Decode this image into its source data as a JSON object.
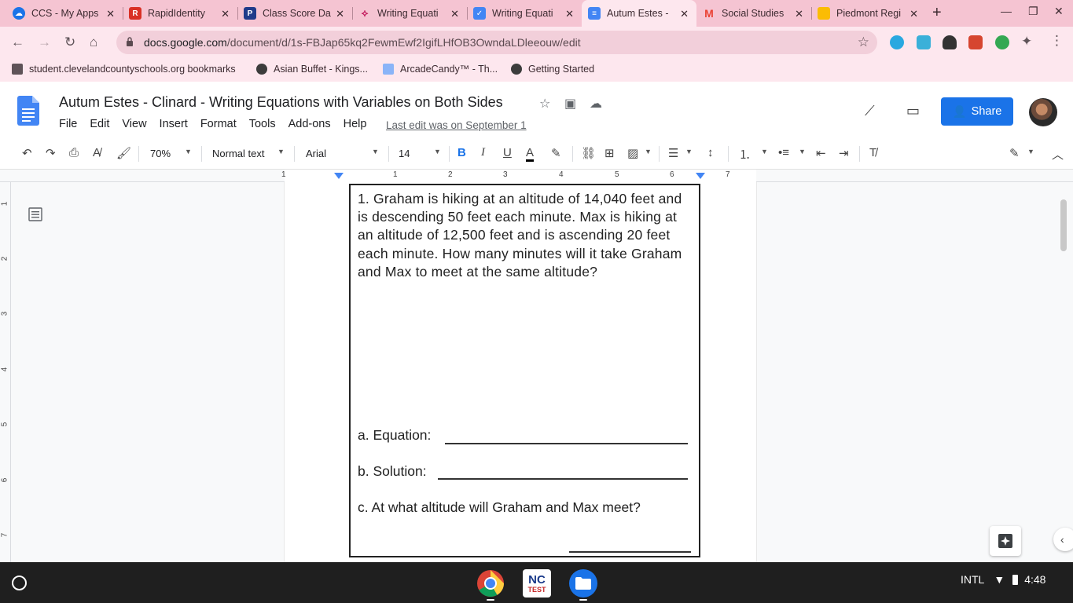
{
  "tabs": [
    {
      "title": "CCS - My Apps",
      "favicon": "cloud-icon",
      "color": "#1a73e8"
    },
    {
      "title": "RapidIdentity",
      "favicon": "rapididentity-icon",
      "color": "#d93025"
    },
    {
      "title": "Class Score Da",
      "favicon": "classscore-icon",
      "color": "#1f3a8a"
    },
    {
      "title": "Writing Equati",
      "favicon": "writing-icon",
      "color": "#c2185b"
    },
    {
      "title": "Writing Equati",
      "favicon": "google-forms-icon",
      "color": "#4285f4"
    },
    {
      "title": "Autum Estes -",
      "favicon": "google-docs-icon",
      "color": "#4285f4"
    },
    {
      "title": "Social Studies",
      "favicon": "gmail-icon",
      "color": "#ea4335"
    },
    {
      "title": "Piedmont Regi",
      "favicon": "google-slides-icon",
      "color": "#fbbc04"
    }
  ],
  "omnibox": {
    "host": "docs.google.com",
    "path": "/document/d/1s-FBJap65kq2FewmEwf2IgifLHfOB3OwndaLDleeouw/edit"
  },
  "bookmarks": [
    "student.clevelandcountyschools.org bookmarks",
    "Asian Buffet - Kings...",
    "ArcadeCandy™ - Th...",
    "Getting Started"
  ],
  "doc": {
    "title": "Autum Estes - Clinard - Writing Equations with Variables on Both Sides",
    "menus": [
      "File",
      "Edit",
      "View",
      "Insert",
      "Format",
      "Tools",
      "Add-ons",
      "Help"
    ],
    "last_edit": "Last edit was on September 1",
    "share_label": "Share"
  },
  "format": {
    "zoom": "70%",
    "style": "Normal text",
    "font": "Arial",
    "size": "14"
  },
  "ruler": [
    "1",
    "1",
    "2",
    "3",
    "4",
    "5",
    "6",
    "7"
  ],
  "vruler": [
    "1",
    "2",
    "3",
    "4",
    "5",
    "6",
    "7"
  ],
  "worksheet": {
    "question": "1. Graham is hiking at an altitude of  14,040 feet and is descending 50 feet each minute. Max is hiking at an altitude of  12,500 feet and is ascending 20 feet each minute. How many minutes will it take Graham and Max to meet at the same altitude?",
    "a": "a. Equation:",
    "b": "b. Solution:",
    "c": "c. At what altitude will Graham and Max meet?"
  },
  "shelf": {
    "ime": "INTL",
    "time": "4:48",
    "nc_label_top": "NC",
    "nc_label_bottom": "TEST"
  }
}
